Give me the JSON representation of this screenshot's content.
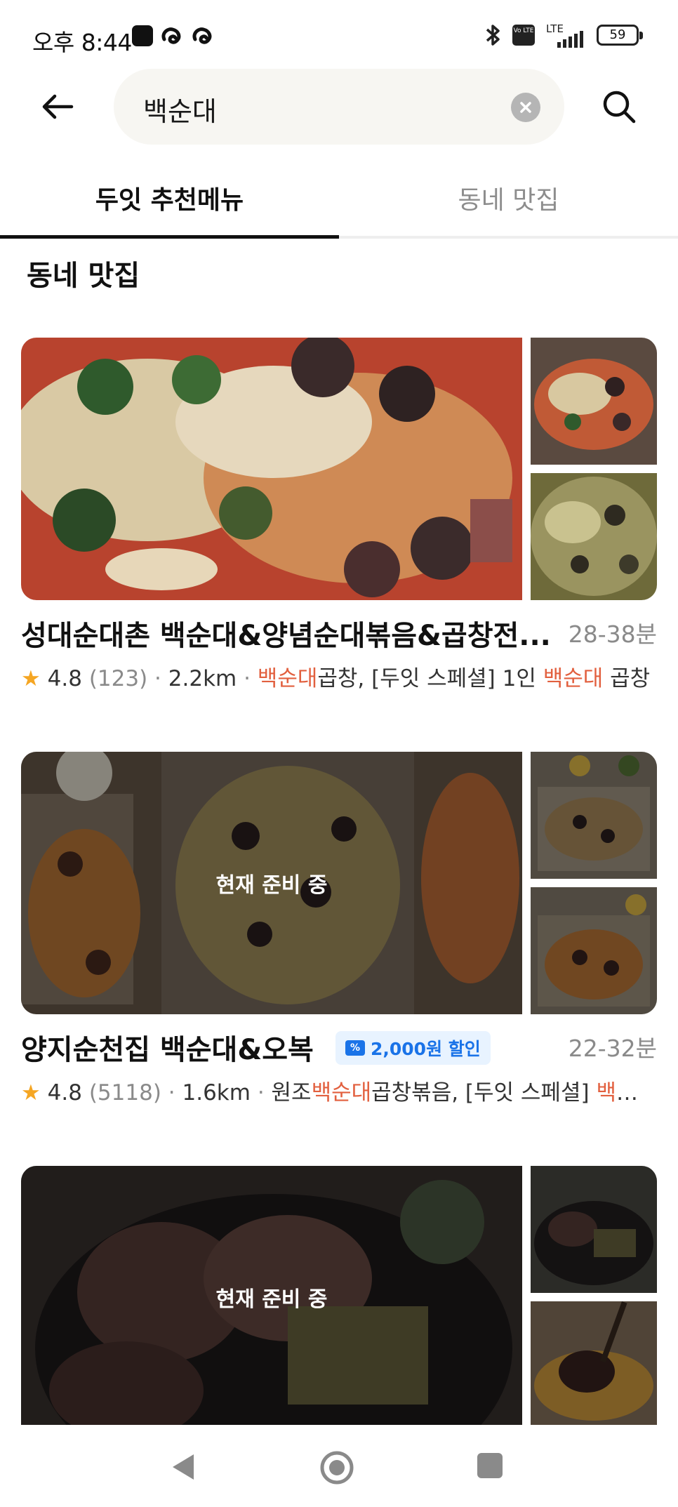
{
  "status_bar": {
    "time": "오후 8:44",
    "network": "LTE",
    "volte": "Vo LTE",
    "battery": "59"
  },
  "search": {
    "query": "백순대"
  },
  "tabs": [
    {
      "label": "두잇 추천메뉴",
      "active": true
    },
    {
      "label": "동네 맛집",
      "active": false
    }
  ],
  "section": {
    "title": "동네 맛집"
  },
  "restaurants": [
    {
      "name": "성대순대촌 백순대&양념순대볶음&곱창전...",
      "eta": "28-38분",
      "rating": "4.8",
      "reviews": "(123)",
      "distance": "2.2km",
      "menu_hl1": "백순대",
      "menu_text1": "곱창, [두잇 스페셜] 1인 ",
      "menu_hl2": "백순대",
      "menu_text2": " 곱창",
      "status_overlay": ""
    },
    {
      "name": "양지순천집 백순대&오복",
      "coupon": "2,000원 할인",
      "eta": "22-32분",
      "rating": "4.8",
      "reviews": "(5118)",
      "distance": "1.6km",
      "menu_pre": "원조",
      "menu_hl1": "백순대",
      "menu_text1": "곱창볶음, [두잇 스페셜] ",
      "menu_hl2": "백순대...",
      "status_overlay": "현재 준비 중"
    },
    {
      "status_overlay": "현재 준비 중"
    }
  ],
  "colors": {
    "accent_highlight": "#e2603f",
    "star": "#f5a623",
    "coupon_blue": "#1a73e8"
  }
}
